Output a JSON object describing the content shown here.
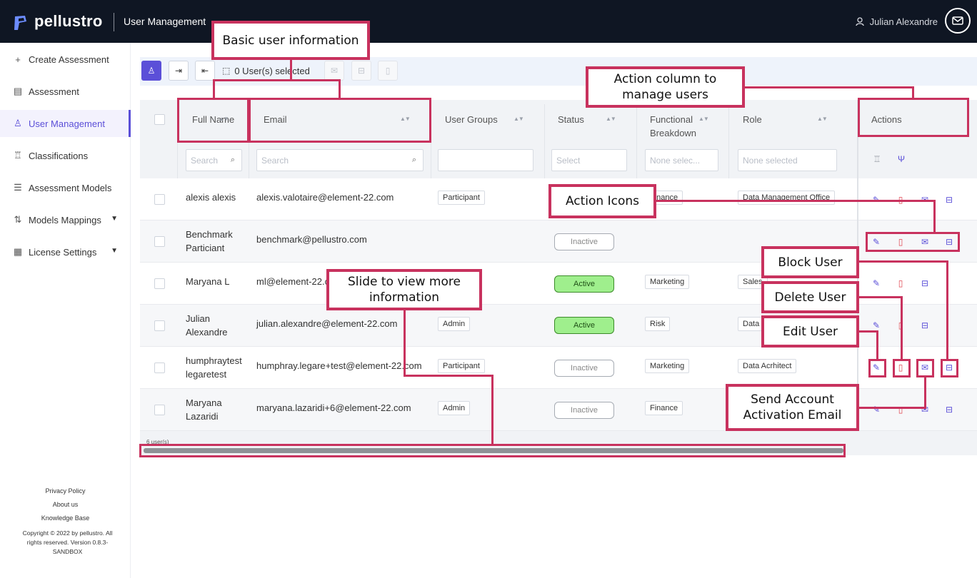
{
  "app": {
    "brand": "pellustro",
    "page_title": "User Management",
    "user_name": "Julian Alexandre"
  },
  "sidebar": {
    "items": [
      {
        "label": "Create Assessment",
        "icon": "plus-icon"
      },
      {
        "label": "Assessment",
        "icon": "document-icon"
      },
      {
        "label": "User Management",
        "icon": "user-icon",
        "active": true
      },
      {
        "label": "Classifications",
        "icon": "hierarchy-icon"
      },
      {
        "label": "Assessment Models",
        "icon": "list-icon"
      },
      {
        "label": "Models Mappings",
        "icon": "mapping-icon",
        "expandable": true
      },
      {
        "label": "License Settings",
        "icon": "license-icon",
        "expandable": true
      }
    ],
    "footer_links": [
      "Privacy Policy",
      "About us",
      "Knowledge Base"
    ],
    "copyright": "Copyright © 2022 by pellustro. All rights reserved. Version 0.8.3-SANDBOX"
  },
  "toolbar": {
    "selected_label": "0 User(s) selected"
  },
  "table": {
    "headers": {
      "full_name": "Full Name",
      "email": "Email",
      "user_groups": "User Groups",
      "status": "Status",
      "functional_breakdown": "Functional Breakdown",
      "role": "Role",
      "actions": "Actions"
    },
    "filters": {
      "full_name": "Search",
      "email": "Search",
      "status": "Select",
      "functional_breakdown": "None selec...",
      "role": "None selected"
    },
    "rows": [
      {
        "name": "alexis alexis",
        "email": "alexis.valotaire@element-22.com",
        "group": "Participant",
        "status": "",
        "breakdown": "Finance",
        "role": "Data Management Office"
      },
      {
        "name": "Benchmark Particiant",
        "email": "benchmark@pellustro.com",
        "group": "",
        "status": "Inactive",
        "breakdown": "",
        "role": ""
      },
      {
        "name": "Maryana L",
        "email": "ml@element-22.com",
        "group": "",
        "status": "Active",
        "breakdown": "Marketing",
        "role": "Sales"
      },
      {
        "name": "Julian Alexandre",
        "email": "julian.alexandre@element-22.com",
        "group": "Admin",
        "status": "Active",
        "breakdown": "Risk",
        "role": "Data"
      },
      {
        "name": "humphraytest legaretest",
        "email": "humphray.legare+test@element-22.com",
        "group": "Participant",
        "status": "Inactive",
        "breakdown": "Marketing",
        "role": "Data Acrhitect"
      },
      {
        "name": "Maryana Lazaridi",
        "email": "maryana.lazaridi+6@element-22.com",
        "group": "Admin",
        "status": "Inactive",
        "breakdown": "Finance",
        "role": ""
      }
    ],
    "footer_count": "6 user(s)"
  },
  "annotations": {
    "basic_info": "Basic user information",
    "action_column": "Action column to manage users",
    "action_icons": "Action Icons",
    "block_user": "Block User",
    "delete_user": "Delete User",
    "edit_user": "Edit User",
    "slide": "Slide to view more information",
    "send_activation": "Send Account Activation Email"
  },
  "colors": {
    "accent": "#5b4fd8",
    "annotation": "#c8325e",
    "topbar": "#0f1623",
    "active_status": "#9fef8d",
    "delete_icon": "#e0444f"
  }
}
